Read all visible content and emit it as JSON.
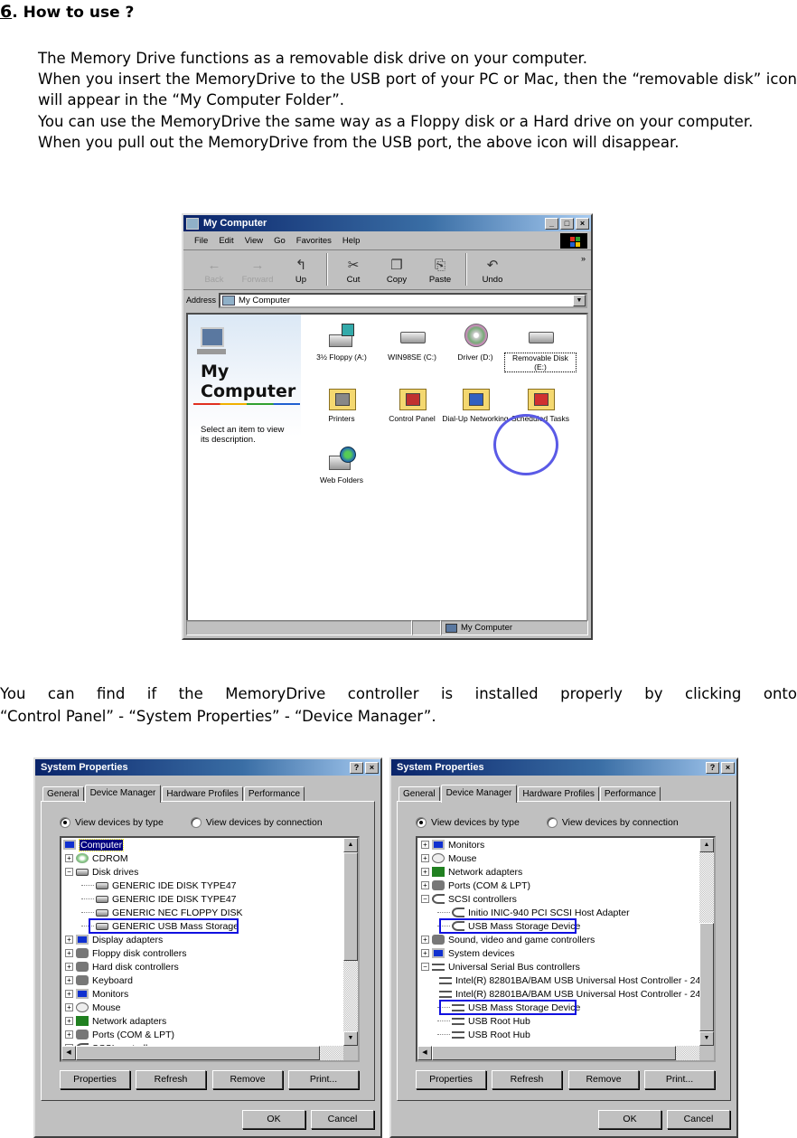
{
  "section": {
    "number": "6",
    "title": ".  How to use ?"
  },
  "intro": {
    "lines": [
      "The Memory Drive functions as a removable disk drive on your computer.",
      "When you insert the MemoryDrive to the USB port of your PC or Mac, then the “removable disk” icon will appear in the “My Computer Folder”.",
      "You can use the MemoryDrive the same way as a Floppy disk or a Hard drive on your computer.",
      "When you pull out the  MemoryDrive from the USB port, the above icon will disappear."
    ]
  },
  "explorer": {
    "title": "My Computer",
    "title_buttons": [
      "_",
      "□",
      "×"
    ],
    "menu": [
      "File",
      "Edit",
      "View",
      "Go",
      "Favorites",
      "Help"
    ],
    "toolbar": [
      {
        "label": "Back",
        "icon": "back-arrow-icon",
        "glyph": "←",
        "disabled": true
      },
      {
        "label": "Forward",
        "icon": "forward-arrow-icon",
        "glyph": "→",
        "disabled": true
      },
      {
        "label": "Up",
        "icon": "up-folder-icon",
        "glyph": "↰",
        "disabled": false
      },
      {
        "label": "Cut",
        "icon": "scissors-icon",
        "glyph": "✂",
        "disabled": false
      },
      {
        "label": "Copy",
        "icon": "copy-icon",
        "glyph": "❐",
        "disabled": false
      },
      {
        "label": "Paste",
        "icon": "paste-icon",
        "glyph": "⎘",
        "disabled": false
      },
      {
        "label": "Undo",
        "icon": "undo-icon",
        "glyph": "↶",
        "disabled": false
      }
    ],
    "toolbar_more": "»",
    "address_label": "Address",
    "address_value": "My Computer",
    "left_pane": {
      "heading_line1": "My",
      "heading_line2": "Computer",
      "description": "Select an item to view its description."
    },
    "items": [
      {
        "label": "3½ Floppy (A:)",
        "icon": "floppy-drive-icon",
        "kind": "floppy"
      },
      {
        "label": "WIN98SE (C:)",
        "icon": "hard-drive-icon",
        "kind": "drive"
      },
      {
        "label": "Driver (D:)",
        "icon": "cd-drive-icon",
        "kind": "cd"
      },
      {
        "label": "Removable Disk (E:)",
        "icon": "removable-disk-icon",
        "kind": "drive",
        "highlighted": true
      },
      {
        "label": "Printers",
        "icon": "printers-folder-icon",
        "kind": "folder"
      },
      {
        "label": "Control Panel",
        "icon": "control-panel-folder-icon",
        "kind": "folder"
      },
      {
        "label": "Dial-Up Networking",
        "icon": "dialup-networking-folder-icon",
        "kind": "folder"
      },
      {
        "label": "Scheduled Tasks",
        "icon": "scheduled-tasks-folder-icon",
        "kind": "folder"
      },
      {
        "label": "Web Folders",
        "icon": "web-folders-icon",
        "kind": "web"
      }
    ],
    "status": "My Computer",
    "highlight_color": "#5a5ae6"
  },
  "middle": {
    "line1": "You can find if the  MemoryDrive controller is installed properly by clicking onto",
    "line2": "“Control Panel” -  “System Properties” -  “Device Manager”."
  },
  "dialogs": [
    {
      "title": "System Properties",
      "title_buttons": [
        "?",
        "×"
      ],
      "tabs": [
        "General",
        "Device Manager",
        "Hardware Profiles",
        "Performance"
      ],
      "active_tab": 1,
      "radios": [
        {
          "label": "View devices by type",
          "checked": true
        },
        {
          "label": "View devices by connection",
          "checked": false
        }
      ],
      "tree": [
        {
          "label": "Computer",
          "level": 0,
          "toggle": "",
          "icon": "pc",
          "selected": true
        },
        {
          "label": "CDROM",
          "level": 1,
          "toggle": "+",
          "icon": "cd"
        },
        {
          "label": "Disk drives",
          "level": 1,
          "toggle": "-",
          "icon": "drv"
        },
        {
          "label": "GENERIC IDE  DISK TYPE47",
          "level": 2,
          "toggle": "",
          "icon": "drv"
        },
        {
          "label": "GENERIC IDE  DISK TYPE47",
          "level": 2,
          "toggle": "",
          "icon": "drv"
        },
        {
          "label": "GENERIC NEC  FLOPPY DISK",
          "level": 2,
          "toggle": "",
          "icon": "drv"
        },
        {
          "label": "GENERIC USB Mass Storage",
          "level": 2,
          "toggle": "",
          "icon": "drv",
          "boxed": true
        },
        {
          "label": "Display adapters",
          "level": 1,
          "toggle": "+",
          "icon": "pc"
        },
        {
          "label": "Floppy disk controllers",
          "level": 1,
          "toggle": "+",
          "icon": "gen"
        },
        {
          "label": "Hard disk controllers",
          "level": 1,
          "toggle": "+",
          "icon": "gen"
        },
        {
          "label": "Keyboard",
          "level": 1,
          "toggle": "+",
          "icon": "gen"
        },
        {
          "label": "Monitors",
          "level": 1,
          "toggle": "+",
          "icon": "pc"
        },
        {
          "label": "Mouse",
          "level": 1,
          "toggle": "+",
          "icon": "mouse"
        },
        {
          "label": "Network adapters",
          "level": 1,
          "toggle": "+",
          "icon": "net"
        },
        {
          "label": "Ports (COM & LPT)",
          "level": 1,
          "toggle": "+",
          "icon": "gen"
        },
        {
          "label": "SCSI controllers",
          "level": 1,
          "toggle": "-",
          "icon": "scsi"
        }
      ],
      "scroll": {
        "vertical_position": 0.0
      },
      "buttons": [
        "Properties",
        "Refresh",
        "Remove",
        "Print..."
      ],
      "footer_buttons": [
        "OK",
        "Cancel"
      ]
    },
    {
      "title": "System Properties",
      "title_buttons": [
        "?",
        "×"
      ],
      "tabs": [
        "General",
        "Device Manager",
        "Hardware Profiles",
        "Performance"
      ],
      "active_tab": 1,
      "radios": [
        {
          "label": "View devices by type",
          "checked": true
        },
        {
          "label": "View devices by connection",
          "checked": false
        }
      ],
      "tree": [
        {
          "label": "Monitors",
          "level": 1,
          "toggle": "+",
          "icon": "pc"
        },
        {
          "label": "Mouse",
          "level": 1,
          "toggle": "+",
          "icon": "mouse"
        },
        {
          "label": "Network adapters",
          "level": 1,
          "toggle": "+",
          "icon": "net"
        },
        {
          "label": "Ports (COM & LPT)",
          "level": 1,
          "toggle": "+",
          "icon": "gen"
        },
        {
          "label": "SCSI controllers",
          "level": 1,
          "toggle": "-",
          "icon": "scsi"
        },
        {
          "label": "Initio INIC-940 PCI SCSI Host Adapter",
          "level": 2,
          "toggle": "",
          "icon": "scsi"
        },
        {
          "label": "USB Mass Storage Device",
          "level": 2,
          "toggle": "",
          "icon": "scsi",
          "boxed": true
        },
        {
          "label": "Sound, video and game controllers",
          "level": 1,
          "toggle": "+",
          "icon": "gen"
        },
        {
          "label": "System devices",
          "level": 1,
          "toggle": "+",
          "icon": "pc"
        },
        {
          "label": "Universal Serial Bus controllers",
          "level": 1,
          "toggle": "-",
          "icon": "usb"
        },
        {
          "label": "Intel(R) 82801BA/BAM USB Universal Host Controller - 24",
          "level": 2,
          "toggle": "",
          "icon": "usb"
        },
        {
          "label": "Intel(R) 82801BA/BAM USB Universal Host Controller - 24",
          "level": 2,
          "toggle": "",
          "icon": "usb"
        },
        {
          "label": "USB Mass Storage Device",
          "level": 2,
          "toggle": "",
          "icon": "usb",
          "boxed": true
        },
        {
          "label": "USB Root Hub",
          "level": 2,
          "toggle": "",
          "icon": "usb"
        },
        {
          "label": "USB Root Hub",
          "level": 2,
          "toggle": "",
          "icon": "usb"
        }
      ],
      "scroll": {
        "vertical_position": 1.0
      },
      "buttons": [
        "Properties",
        "Refresh",
        "Remove",
        "Print..."
      ],
      "footer_buttons": [
        "OK",
        "Cancel"
      ]
    }
  ],
  "colors": {
    "highlight_box": "#1010e0",
    "titlebar_start": "#0a246a",
    "titlebar_end": "#a6caf0"
  }
}
